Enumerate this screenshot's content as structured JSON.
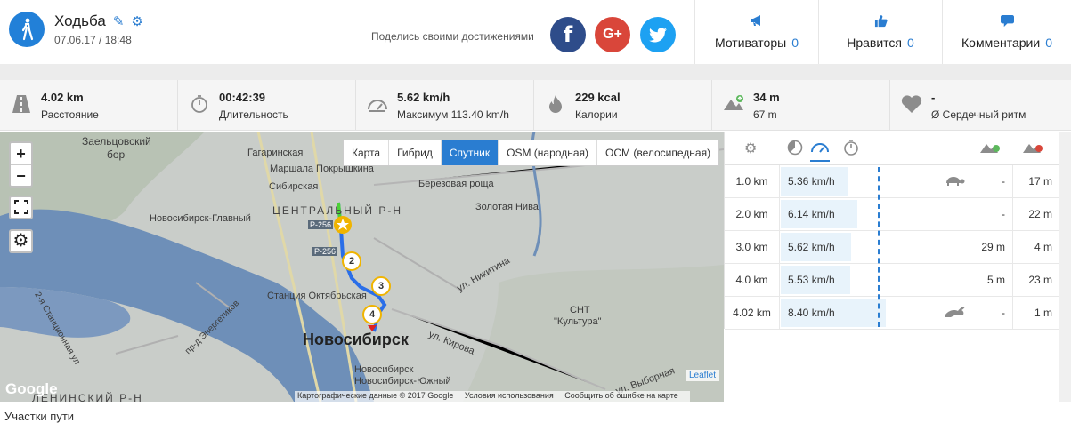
{
  "activity": {
    "title": "Ходьба",
    "date": "07.06.17 / 18:48"
  },
  "share": {
    "text": "Поделись своими достижениями",
    "facebook": "f",
    "googleplus": "G+"
  },
  "header_stats": [
    {
      "label": "Мотиваторы",
      "count": "0",
      "icon": "megaphone-icon"
    },
    {
      "label": "Нравится",
      "count": "0",
      "icon": "thumbs-up-icon"
    },
    {
      "label": "Комментарии",
      "count": "0",
      "icon": "comment-icon"
    }
  ],
  "stats": [
    {
      "value": "4.02 km",
      "label": "Расстояние",
      "icon": "road-icon"
    },
    {
      "value": "00:42:39",
      "label": "Длительность",
      "icon": "stopwatch-icon"
    },
    {
      "value": "5.62 km/h",
      "label": "Максимум 113.40 km/h",
      "icon": "speedometer-icon"
    },
    {
      "value": "229 kcal",
      "label": "Калории",
      "icon": "flame-icon"
    },
    {
      "value": "34 m",
      "label": "67 m",
      "icon": "elevation-icon"
    },
    {
      "value": "-",
      "label": "Ø Сердечный ритм",
      "icon": "heart-icon"
    }
  ],
  "map": {
    "tabs": [
      "Карта",
      "Гибрид",
      "Спутник",
      "OSM (народная)",
      "OCM (велосипедная)"
    ],
    "active_tab": "Спутник",
    "zoom_in": "+",
    "zoom_out": "−",
    "labels": {
      "zaeltsovsky": "Заельцовский",
      "bor": "бор",
      "gagarinskaya": "Гагаринская",
      "marshala": "Маршала Покрышкина",
      "sibirskaya": "Сибирская",
      "berezovaya": "Березовая роща",
      "zolotaya": "Золотая Нива",
      "central": "ЦЕНТРАЛЬНЫЙ Р-Н",
      "novosib_glavny": "Новосибирск-Главный",
      "r256a": "Р-256",
      "r256b": "Р-256",
      "oktyabrskaya": "Станция Октябрьская",
      "city": "Новосибирск",
      "snt": "СНТ",
      "kultura": "\"Культура\"",
      "kirova": "ул. Кирова",
      "nikitina": "ул. Никитина",
      "vybornaya": "ул. Выборная",
      "south1": "Новосибирск",
      "south2": "Новосибирск-Южный",
      "stantsionnaya": "2-я Станционная ул",
      "energetikov": "пр-д Энергетиков",
      "leninsky": "ЛЕНИНСКИЙ Р-Н"
    },
    "markers": [
      "2",
      "3",
      "4"
    ],
    "attribution": [
      "Картографические данные © 2017 Google",
      "Условия использования",
      "Сообщить об ошибке на карте"
    ],
    "leaflet": "Leaflet",
    "google": "Google"
  },
  "splits": {
    "rows": [
      {
        "dist": "1.0 km",
        "speed": "5.36 km/h",
        "speed_kmh": 5.36,
        "animal": "turtle-icon",
        "up": "-",
        "down": "17 m"
      },
      {
        "dist": "2.0 km",
        "speed": "6.14 km/h",
        "speed_kmh": 6.14,
        "animal": "",
        "up": "-",
        "down": "22 m"
      },
      {
        "dist": "3.0 km",
        "speed": "5.62 km/h",
        "speed_kmh": 5.62,
        "animal": "",
        "up": "29 m",
        "down": "4 m"
      },
      {
        "dist": "4.0 km",
        "speed": "5.53 km/h",
        "speed_kmh": 5.53,
        "animal": "",
        "up": "5 m",
        "down": "23 m"
      },
      {
        "dist": "4.02 km",
        "speed": "8.40 km/h",
        "speed_kmh": 8.4,
        "animal": "rabbit-icon",
        "up": "-",
        "down": "1 m"
      }
    ]
  },
  "footer": "Участки пути"
}
